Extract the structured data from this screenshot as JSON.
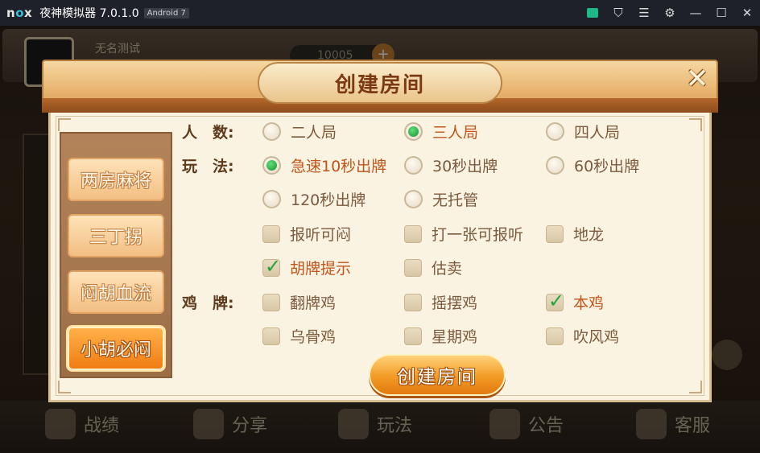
{
  "titlebar": {
    "logo": "nox",
    "app_title": "夜神模拟器 7.0.1.0",
    "android_badge": "Android 7",
    "icons": [
      "store-icon",
      "shirt-icon",
      "menu-icon",
      "gear-icon",
      "minimize-icon",
      "maximize-icon",
      "close-icon"
    ]
  },
  "background": {
    "user_name": "无名测试",
    "coins": "10005",
    "plus": "+",
    "nav": [
      {
        "label": "战绩",
        "icon": "trophy-icon"
      },
      {
        "label": "分享",
        "icon": "share-icon"
      },
      {
        "label": "玩法",
        "icon": "rules-icon"
      },
      {
        "label": "公告",
        "icon": "mail-icon"
      },
      {
        "label": "客服",
        "icon": "support-icon"
      }
    ]
  },
  "modal": {
    "title": "创建房间",
    "close_symbol": "✕",
    "categories": [
      {
        "label": "两房麻将",
        "active": false
      },
      {
        "label": "三丁拐",
        "active": false
      },
      {
        "label": "闷胡血流",
        "active": false
      },
      {
        "label": "小胡必闷",
        "active": true
      }
    ],
    "players_label": "人　数:",
    "players": [
      {
        "label": "二人局",
        "selected": false
      },
      {
        "label": "三人局",
        "selected": true
      },
      {
        "label": "四人局",
        "selected": false
      }
    ],
    "play_label": "玩　法:",
    "play_speed": [
      {
        "label": "急速10秒出牌",
        "selected": true
      },
      {
        "label": "30秒出牌",
        "selected": false
      },
      {
        "label": "60秒出牌",
        "selected": false
      },
      {
        "label": "120秒出牌",
        "selected": false
      },
      {
        "label": "无托管",
        "selected": false
      }
    ],
    "play_rules": [
      {
        "label": "报听可闷",
        "checked": false
      },
      {
        "label": "打一张可报听",
        "checked": false
      },
      {
        "label": "地龙",
        "checked": false
      },
      {
        "label": "胡牌提示",
        "checked": true
      },
      {
        "label": "估卖",
        "checked": false
      }
    ],
    "chicken_label": "鸡　牌:",
    "chicken": [
      {
        "label": "翻牌鸡",
        "checked": false
      },
      {
        "label": "摇摆鸡",
        "checked": false
      },
      {
        "label": "本鸡",
        "checked": true
      },
      {
        "label": "乌骨鸡",
        "checked": false
      },
      {
        "label": "星期鸡",
        "checked": false
      },
      {
        "label": "吹风鸡",
        "checked": false
      }
    ],
    "create_button": "创建房间"
  }
}
